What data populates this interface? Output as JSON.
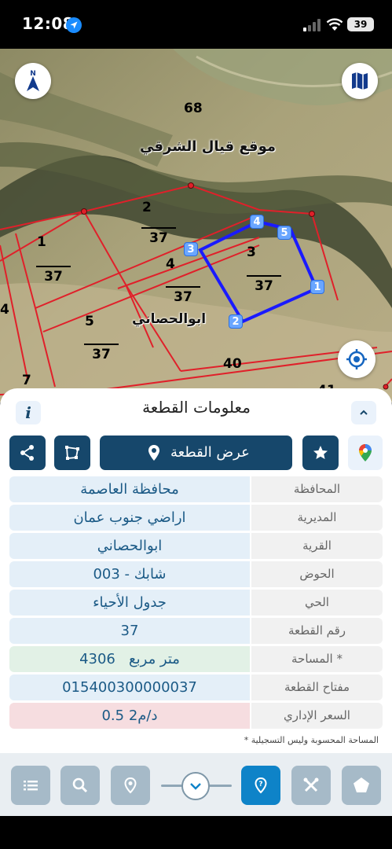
{
  "status_bar": {
    "time": "12:08",
    "battery": "39"
  },
  "map": {
    "place_label": "موقع قيال الشرقي",
    "village_label": "ابوالحصاني",
    "numbers": {
      "n68": "68",
      "n2": "2",
      "n1": "1",
      "n4a": "4",
      "n4b": "4",
      "n3": "3",
      "n5": "5",
      "n40": "40",
      "n7": "7",
      "n41": "41"
    },
    "parcel_fractions": {
      "f1": "37",
      "f2": "37",
      "f3": "37",
      "f4": "37",
      "f5": "37"
    },
    "vertices": [
      "1",
      "2",
      "3",
      "4",
      "5"
    ],
    "boundary_color": "#1a1aff",
    "lines_color": "#e0202a"
  },
  "sheet": {
    "info_icon": "i",
    "title": "معلومات القطعة",
    "show_parcel_label": "عرض القطعة",
    "rows": [
      {
        "label": "المحافظة",
        "value": "محافظة العاصمة"
      },
      {
        "label": "المديرية",
        "value": "اراضي جنوب عمان"
      },
      {
        "label": "القرية",
        "value": "ابوالحصاني"
      },
      {
        "label": "الحوض",
        "value": "شابك - 003"
      },
      {
        "label": "الحي",
        "value": "جدول الأحياء"
      },
      {
        "label": "رقم القطعة",
        "value": "37"
      },
      {
        "label": "المساحة *",
        "value": "4306   متر مربع"
      },
      {
        "label": "مفتاح القطعة",
        "value": "015400300000037"
      },
      {
        "label": "السعر الإداري",
        "value": "0.5 د/م2"
      }
    ],
    "footnote": "* المساحة المحسوبة وليس التسجيلية"
  },
  "colors": {
    "primary": "#16476b",
    "accent": "#0e83c8",
    "value_text": "#1b5a86"
  }
}
